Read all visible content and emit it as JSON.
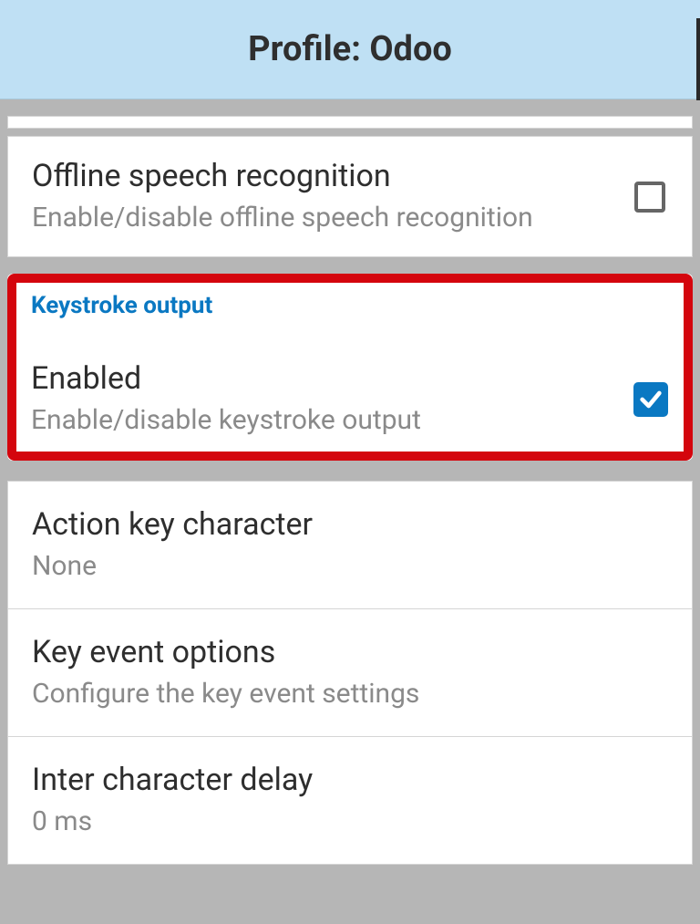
{
  "header": {
    "title": "Profile: Odoo"
  },
  "offline_speech": {
    "title": "Offline speech recognition",
    "subtitle": "Enable/disable offline speech recognition",
    "checked": false
  },
  "keystroke_section": {
    "header": "Keystroke output",
    "enabled_item": {
      "title": "Enabled",
      "subtitle": "Enable/disable keystroke output",
      "checked": true
    }
  },
  "action_key": {
    "title": "Action key character",
    "value": "None"
  },
  "key_event_options": {
    "title": "Key event options",
    "subtitle": "Configure the key event settings"
  },
  "inter_char_delay": {
    "title": "Inter character delay",
    "value": "0 ms"
  }
}
